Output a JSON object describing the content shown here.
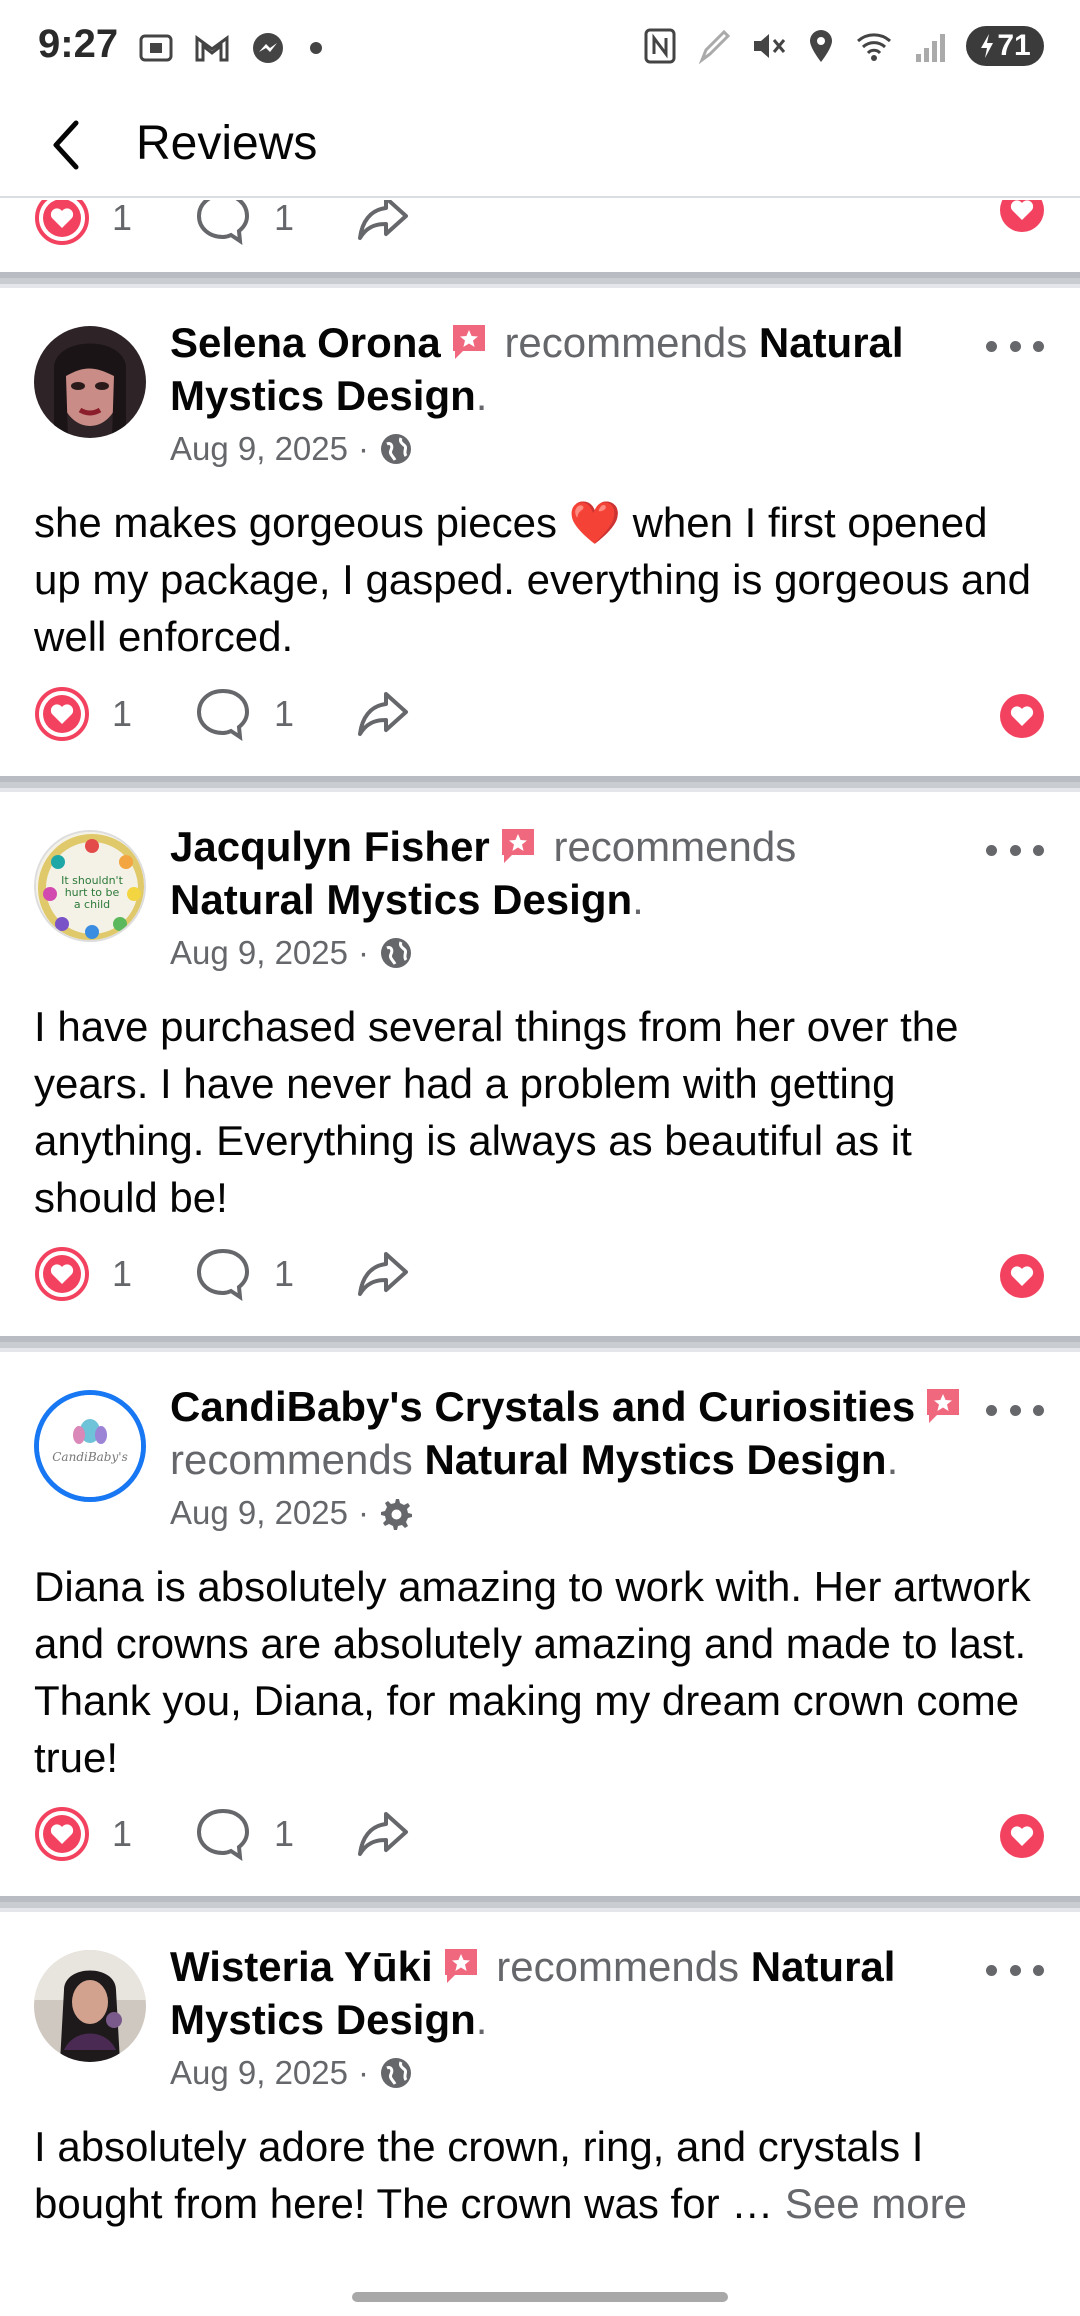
{
  "status_bar": {
    "time": "9:27",
    "battery": "71",
    "left_icons": [
      "screenshot-icon",
      "gmail-icon",
      "messenger-icon",
      "dot-icon"
    ],
    "right_icons": [
      "nfc-icon",
      "edit-icon",
      "mute-icon",
      "location-icon",
      "wifi-icon",
      "signal-icon"
    ]
  },
  "header": {
    "title": "Reviews"
  },
  "top_partial": {
    "reaction_count": "1",
    "comment_count": "1"
  },
  "reviews": [
    {
      "author": "Selena Orona",
      "verb": "recommends",
      "page_line1": "Natural",
      "page_line2": "Mystics Design",
      "date": "Aug 9, 2025",
      "privacy": "globe-icon",
      "text": "she makes gorgeous pieces ❤️ when I first opened up my package, I gasped. everything is gorgeous and well enforced.",
      "reaction_count": "1",
      "comment_count": "1"
    },
    {
      "author": "Jacqulyn Fisher",
      "verb": "recommends",
      "page": "Natural Mystics Design",
      "date": "Aug 9, 2025",
      "privacy": "globe-icon",
      "avatar_text": "It shouldn't hurt to be a child",
      "text": "I have purchased several things from her over the years. I have never had a problem with getting anything. Everything is always as beautiful as it should be!",
      "reaction_count": "1",
      "comment_count": "1"
    },
    {
      "author": "CandiBaby's Crystals and Curiosities",
      "verb": "recommends",
      "page": "Natural Mystics Design",
      "date": "Aug 9, 2025",
      "privacy": "gear-icon",
      "avatar_text": "CandiBaby's",
      "text": "Diana is absolutely amazing to work with. Her artwork and crowns are absolutely amazing and made to last. Thank you, Diana, for making my dream crown come true!",
      "reaction_count": "1",
      "comment_count": "1"
    },
    {
      "author": "Wisteria Yūki",
      "verb": "recommends",
      "page_line1": "Natural",
      "page_line2": "Mystics Design",
      "date": "Aug 9, 2025",
      "privacy": "globe-icon",
      "text": "I absolutely adore the crown, ring, and crystals I bought from here!  The crown was for …",
      "see_more": "See more"
    }
  ],
  "colors": {
    "heart_red": "#f3425f",
    "secondary_text": "#65676b",
    "badge_pink": "#f0687e"
  }
}
